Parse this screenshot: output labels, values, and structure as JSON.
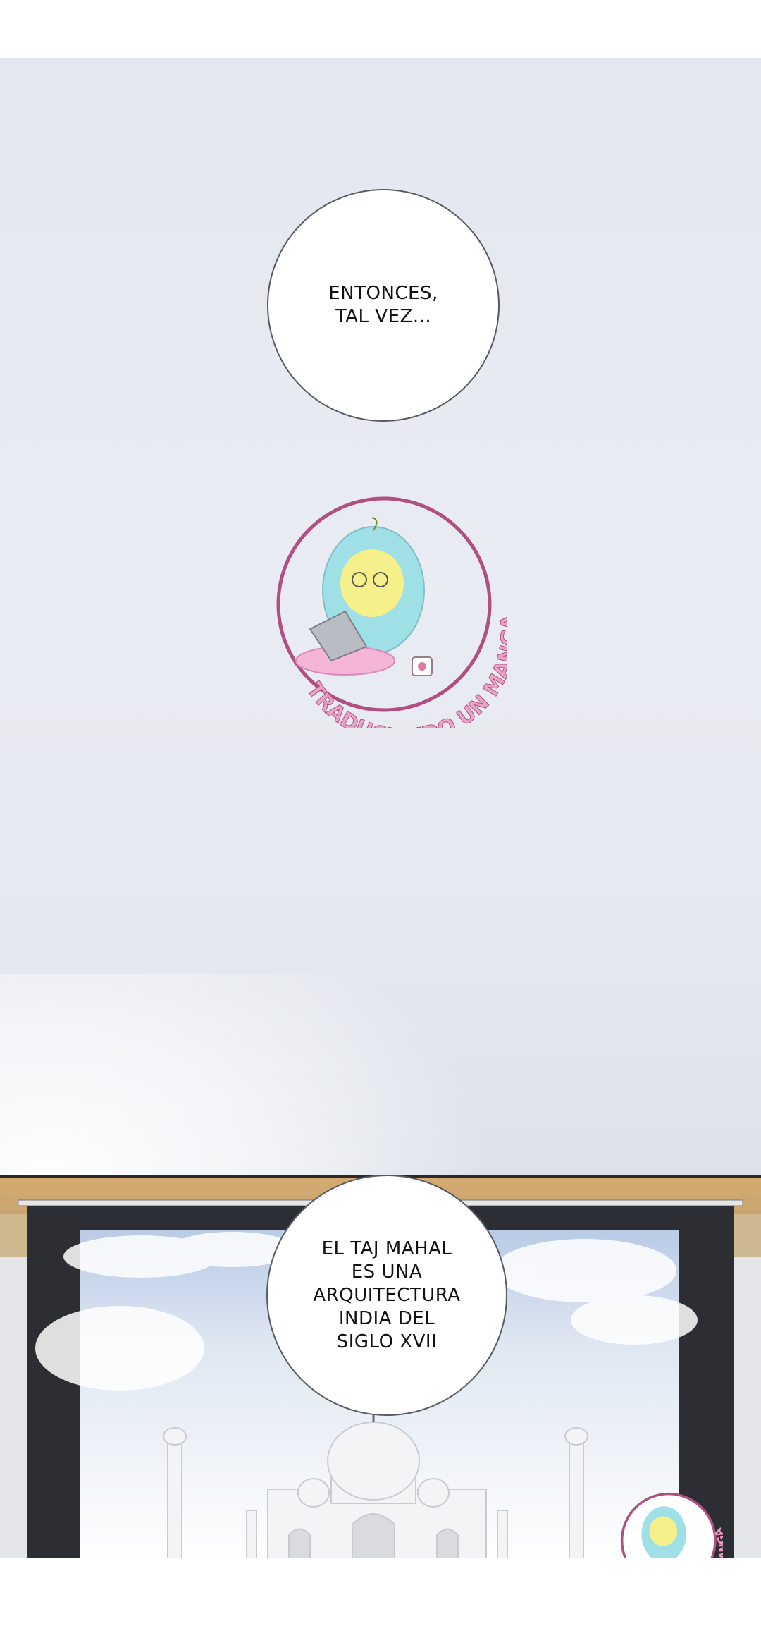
{
  "bubbles": {
    "first": "ENTONCES,\nTAL VEZ...",
    "second": "EL TAJ MAHAL\nES UNA\nARQUITECTURA\nINDIA DEL\nSIGLO XVII"
  },
  "watermark": {
    "text": "TRADUCIENDO UN MANGA",
    "ring_color": "#b14f82",
    "text_color": "#e9a3c7",
    "character_color": "#9fe0e6"
  },
  "colors": {
    "sky": "#e6e9ef",
    "frame_beige": "#c5ae7f",
    "window_frame": "#2b2d31"
  }
}
